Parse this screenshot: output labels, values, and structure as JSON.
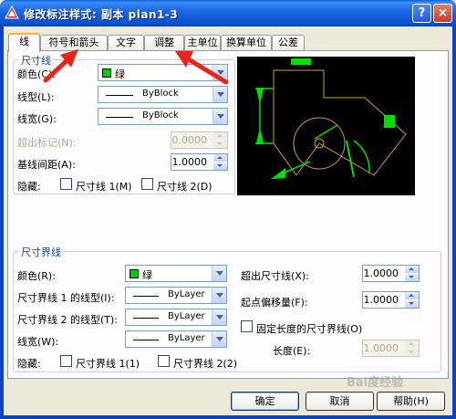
{
  "window": {
    "title": "修改标注样式: 副本 plan1-3",
    "help": "?",
    "close": "×"
  },
  "tabs": [
    {
      "label": "线",
      "active": true
    },
    {
      "label": "符号和箭头"
    },
    {
      "label": "文字"
    },
    {
      "label": "调整"
    },
    {
      "label": "主单位"
    },
    {
      "label": "换算单位"
    },
    {
      "label": "公差"
    }
  ],
  "dim_lines": {
    "title": "尺寸线",
    "color_label": "颜色(C):",
    "color_value": "绿",
    "linetype_label": "线型(L):",
    "linetype_value": "ByBlock",
    "lineweight_label": "线宽(G):",
    "lineweight_value": "ByBlock",
    "extend_label": "超出标记(N):",
    "extend_value": "0.0000",
    "baseline_label": "基线间距(A):",
    "baseline_value": "1.0000",
    "suppress_label": "隐藏:",
    "suppress_1": "尺寸线 1(M)",
    "suppress_2": "尺寸线 2(D)"
  },
  "ext_lines": {
    "title": "尺寸界线",
    "color_label": "颜色(R):",
    "color_value": "绿",
    "lt1_label": "尺寸界线 1 的线型(I):",
    "lt1_value": "ByLayer",
    "lt2_label": "尺寸界线 2 的线型(T):",
    "lt2_value": "ByLayer",
    "lineweight_label": "线宽(W):",
    "lineweight_value": "ByLayer",
    "suppress_label": "隐藏:",
    "suppress_1": "尺寸界线 1(1)",
    "suppress_2": "尺寸界线 2(2)",
    "beyond_label": "超出尺寸线(X):",
    "beyond_value": "1.0000",
    "offset_label": "起点偏移量(F):",
    "offset_value": "1.0000",
    "fixed_label": "固定长度的尺寸界线(O)",
    "length_label": "长度(E):",
    "length_value": "1.0000"
  },
  "buttons": {
    "ok": "确定",
    "cancel": "取消",
    "help": "帮助(H)"
  },
  "watermark": "Bai度经验",
  "colors": {
    "accent_green": "#00d000",
    "preview_bg": "#000000",
    "arrow_red": "#e8231a"
  }
}
